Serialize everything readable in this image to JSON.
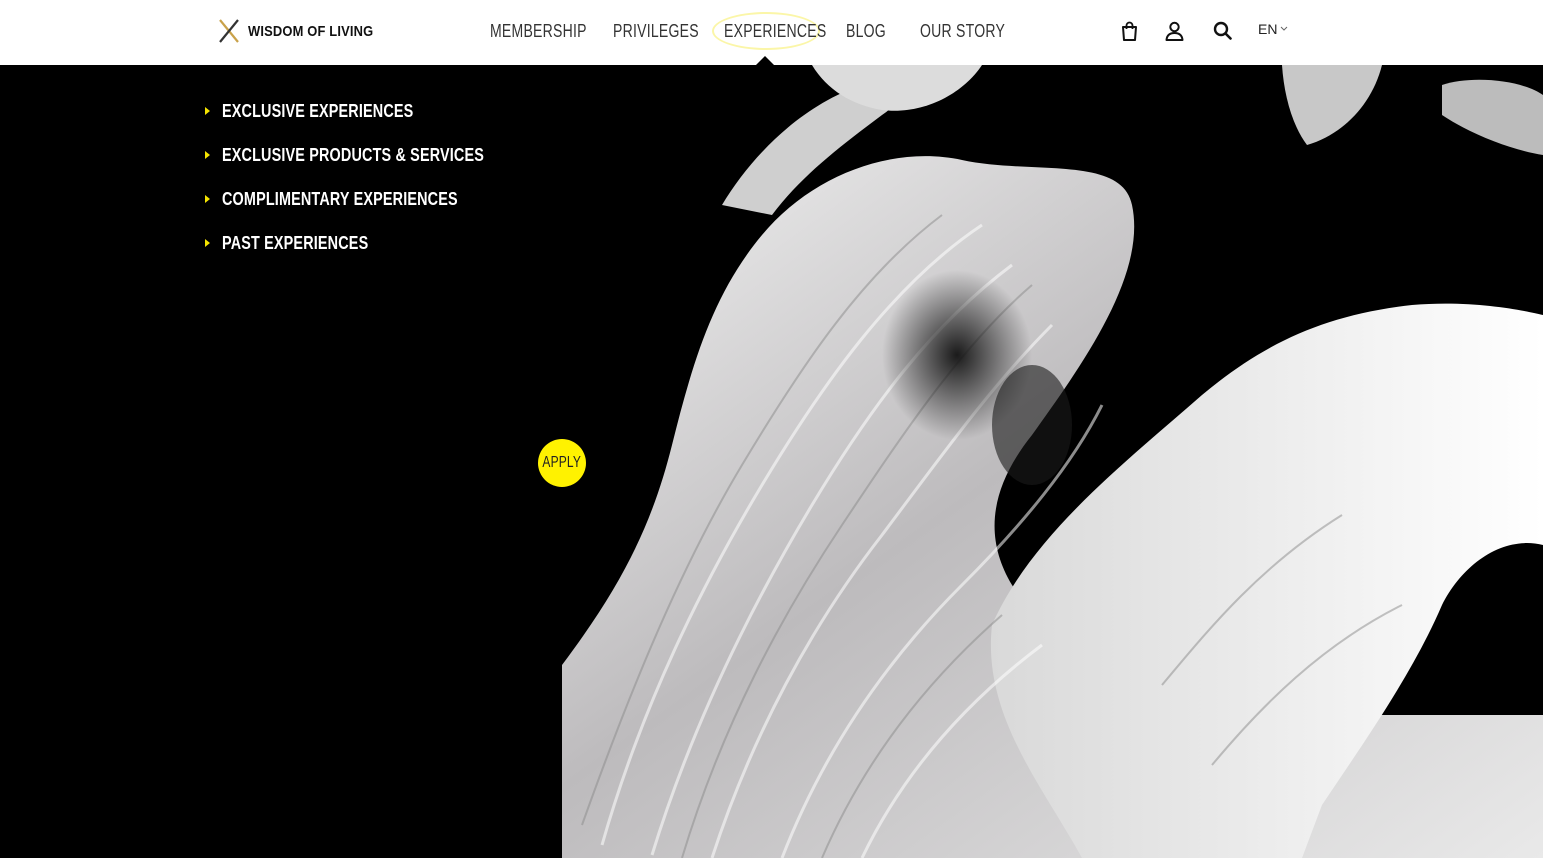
{
  "header": {
    "logo_text": "WISDOM OF LIVING",
    "nav": [
      {
        "label": "MEMBERSHIP"
      },
      {
        "label": "PRIVILEGES"
      },
      {
        "label": "EXPERIENCES",
        "active": true
      },
      {
        "label": "BLOG"
      },
      {
        "label": "OUR STORY"
      }
    ],
    "icons": [
      "bag-icon",
      "user-icon",
      "search-icon"
    ],
    "language": "EN"
  },
  "dropdown": {
    "items": [
      {
        "label": "EXCLUSIVE EXPERIENCES"
      },
      {
        "label": "EXCLUSIVE PRODUCTS & SERVICES"
      },
      {
        "label": "COMPLIMENTARY EXPERIENCES"
      },
      {
        "label": "PAST EXPERIENCES"
      }
    ]
  },
  "apply_button": {
    "label": "APPLY"
  },
  "colors": {
    "accent_yellow": "#fff200",
    "arrow_yellow": "#f5e400",
    "ring_yellow": "#fbf6a8",
    "header_bg": "#ffffff",
    "page_bg": "#000000"
  }
}
